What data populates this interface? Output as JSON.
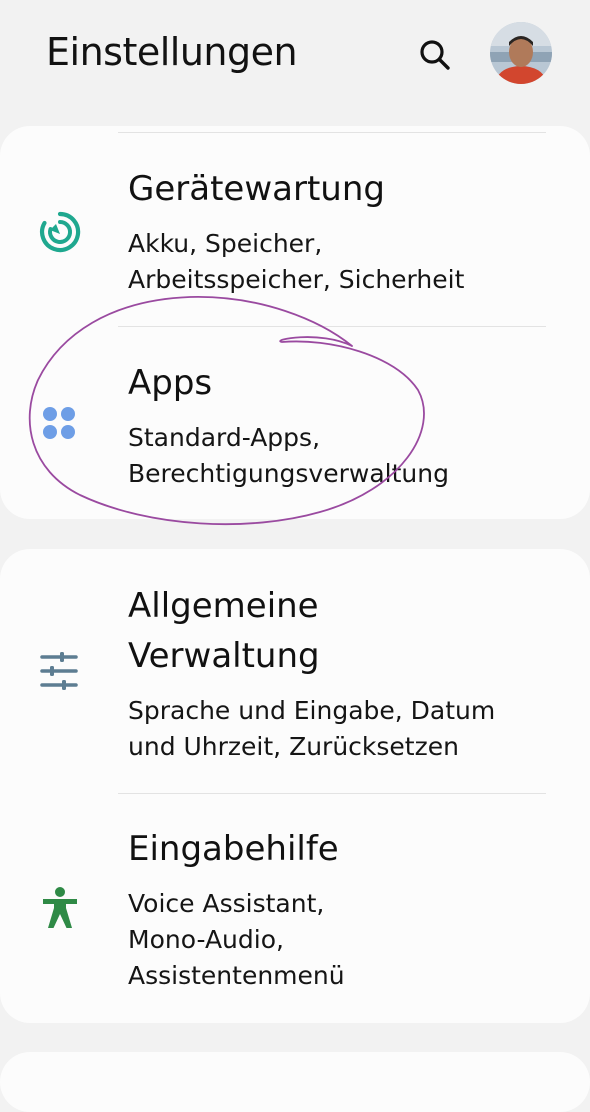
{
  "header": {
    "title": "Einstellungen",
    "search_icon": "search-icon",
    "avatar_icon": "user-avatar"
  },
  "items": [
    {
      "title": "Gerätewartung",
      "sub_line1": "Akku, Speicher,",
      "sub_line2": "Arbeitsspeicher, Sicherheit",
      "icon": "device-care-icon",
      "icon_color": "#1fa88f"
    },
    {
      "title": "Apps",
      "sub_line1": "Standard-Apps,",
      "sub_line2": "Berechtigungsverwaltung",
      "icon": "apps-icon",
      "icon_color": "#6e9ee6"
    },
    {
      "title_line1": "Allgemeine",
      "title_line2": "Verwaltung",
      "sub_line1": "Sprache und Eingabe, Datum",
      "sub_line2": "und Uhrzeit, Zurücksetzen",
      "icon": "general-management-icon",
      "icon_color": "#5d7d92"
    },
    {
      "title": "Eingabehilfe",
      "sub_line1": "Voice Assistant,",
      "sub_line2": "Mono-Audio,",
      "sub_line3": "Assistentenmenü",
      "icon": "accessibility-icon",
      "icon_color": "#2f8a46"
    }
  ],
  "colors": {
    "background": "#f2f2f2",
    "card": "#fcfcfc",
    "annotation": "#9a4aa0"
  }
}
